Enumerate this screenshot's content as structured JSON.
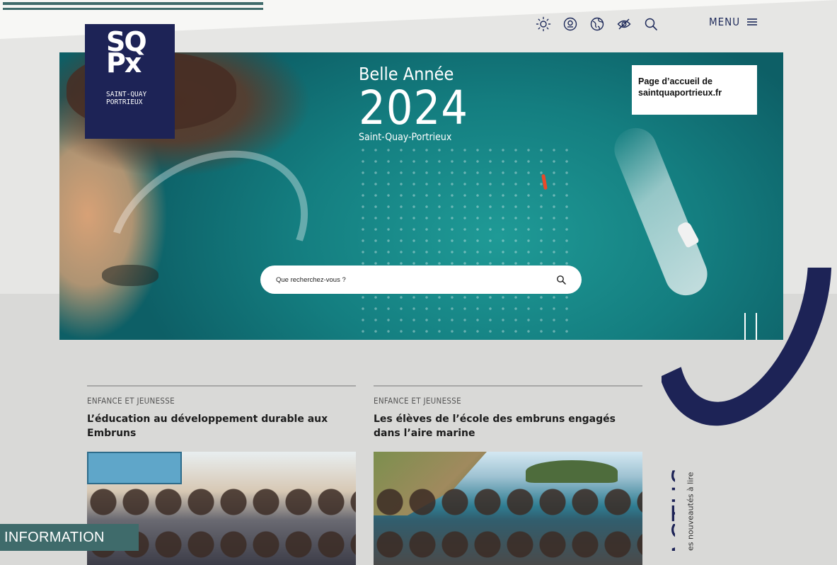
{
  "header": {
    "menu_label": "MENU",
    "tools": [
      {
        "icon": "brightness-icon"
      },
      {
        "icon": "accessibility-icon"
      },
      {
        "icon": "language-globe-icon"
      },
      {
        "icon": "hide-eye-icon"
      },
      {
        "icon": "search-icon"
      }
    ]
  },
  "logo": {
    "mark": "SQPx",
    "name_line1": "SAINT-QUAY",
    "name_line2": "PORTRIEUX"
  },
  "hero": {
    "line1": "Belle Année",
    "year": "2024",
    "line3": "Saint-Quay-Portrieux"
  },
  "callout": {
    "line1": "Page d’accueil de",
    "line2": "saintquaportrieux.fr"
  },
  "search": {
    "placeholder": "Que recherchez-vous ?"
  },
  "news": [
    {
      "category": "ENFANCE ET JEUNESSE",
      "title": "L’éducation au développement durable aux Embruns"
    },
    {
      "category": "ENFANCE ET JEUNESSE",
      "title": "Les élèves de l’école des embruns engagés dans l’aire marine"
    }
  ],
  "actus": {
    "heading": "ACTUS",
    "subtitle": "Des nouveautés à lire"
  },
  "info_tag": "INFORMATION",
  "colors": {
    "navy": "#1d2356",
    "teal_band": "#3f6b6b",
    "page_bg": "#d9d9d7"
  }
}
